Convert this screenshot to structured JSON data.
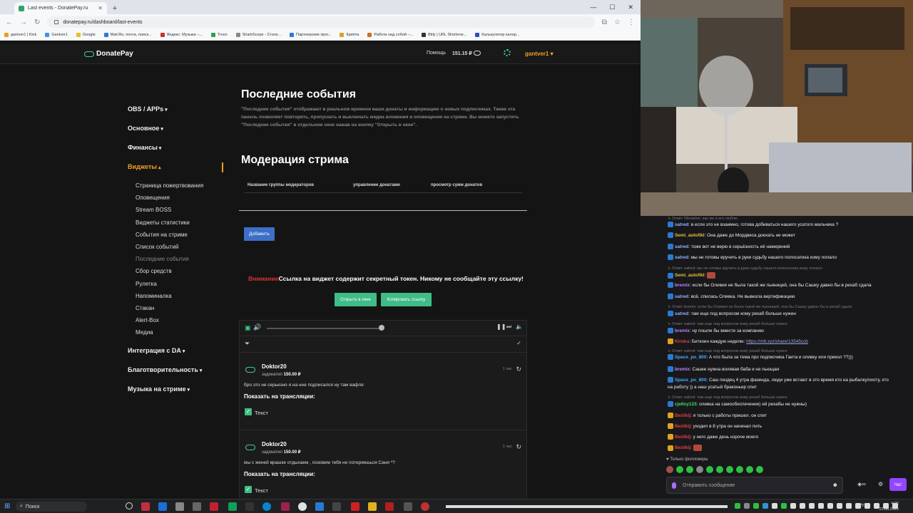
{
  "browser": {
    "tab_title": "Last events - DonatePay.ru",
    "url": "donatepay.ru/dashboard/last-events",
    "bookmarks": [
      "gantver1 | Kick",
      "Gantver1",
      "Google",
      "Mail.Ru: почта, поиск...",
      "Яндекс: Музыка –...",
      "Trovo",
      "SharkScope - Стати...",
      "Партнерские прог...",
      "Крипта",
      "Работа над собой –...",
      "Bitly | URL Shortene...",
      "Калькулятор калор..."
    ]
  },
  "header": {
    "logo": "DonatePay",
    "help": "Помощь",
    "balance": "151.15 ₽",
    "username": "gantver1"
  },
  "sidebar": {
    "groups": [
      "OBS / APPs",
      "Основное",
      "Финансы",
      "Виджеты",
      "Интеграция с DA",
      "Благотворительность",
      "Музыка на стриме"
    ],
    "widget_items": [
      "Страница пожертвования",
      "Оповещения",
      "Stream BOSS",
      "Виджеты статистики",
      "События на стриме",
      "Список событий",
      "Последние события",
      "Сбор средств",
      "Рулетка",
      "Напоминалка",
      "Стакан",
      "Alert-Box",
      "Медиа"
    ]
  },
  "main": {
    "title": "Последние события",
    "description": "\"Последние события\" отображают в реальном времени ваши донаты и информацию о новых подписчиках. Также эта панель позволяет повторять, пропускать и выключать медиа вложения и оповещения на стриме. Вы можете запустить \"Последние события\" в отдельном окне нажав на кнопку \"Открыть в окне\".",
    "moderation_title": "Модерация стрима",
    "mod_columns": [
      "Название группы модераторов",
      "управление донатами",
      "просмотр сумм донатов"
    ],
    "add_button": "Добавить",
    "warning_prefix": "Внимание",
    "warning_text": "Ссылка на виджет содержит секретный токен. Никому не сообщайте эту ссылку!",
    "open_window": "Открыть в окне",
    "copy_link": "Копировать ссылку",
    "events": [
      {
        "name": "Doktor20",
        "donated_label": "задонатил",
        "amount": "150.00 ₽",
        "time": "1 час",
        "message": "бро это не серьезно я на нее подписался ну там вафля",
        "show_label": "Показать на трансляции:",
        "check_label": "Текст"
      },
      {
        "name": "Doktor20",
        "donated_label": "задонатил",
        "amount": "150.00 ₽",
        "time": "1 час",
        "message": "мы с женей врашке отдыхаем , позовем тебя не потеряешься Саня *?",
        "show_label": "Показать на трансляции:",
        "check_label": "Текст"
      }
    ]
  },
  "chat": {
    "lines": [
      {
        "type": "reply",
        "text": "Ответ Obviative: как же я его люблю"
      },
      {
        "user": "satred",
        "color": "#8fb4ff",
        "text": "в если это не взаимно, готова добиваться нашего усатого мальчика ?"
      },
      {
        "user": "Semi_autofikl",
        "color": "#e0c040",
        "text": "Она даже до Мордвеса доехать не может"
      },
      {
        "user": "satred",
        "color": "#8fb4ff",
        "text": "тоже вот не верю в серьёзность её намерений"
      },
      {
        "user": "satred",
        "color": "#8fb4ff",
        "text": "мы не готовы вручить в руки судьбу нашего полосатика кому попало"
      },
      {
        "type": "reply",
        "text": "Ответ satred: мы не готовы вручить в руки судьбу нашего полосатика кому попало"
      },
      {
        "user": "Semi_autofikl",
        "color": "#e0c040",
        "text": ""
      },
      {
        "user": "bremix",
        "color": "#c080ff",
        "text": "если бы Оливия не была такой же пьяницей, она бы Сашку давно бы в рехаб сдала"
      },
      {
        "user": "satred",
        "color": "#8fb4ff",
        "text": "всё, спилась Оливка. Не вывезла вертификацию"
      },
      {
        "type": "reply",
        "text": "Ответ bremix: если бы Оливия не была такой же пьяницей, она бы Сашку давно бы в рехаб сдала"
      },
      {
        "user": "satred",
        "color": "#8fb4ff",
        "text": "там еще под вопросом кому рехаб больше нужен"
      },
      {
        "type": "reply",
        "text": "Ответ satred: там еще под вопросом кому рехаб больше нужен"
      },
      {
        "user": "bremix",
        "color": "#c080ff",
        "text": "ну пошли бы вместе за компанию"
      },
      {
        "user": "Kiroku",
        "color": "#e04040",
        "text": "Биткоин каждую неделю: ",
        "link": "https://mtt.xyz/share/13545ccb"
      },
      {
        "type": "reply",
        "text": "Ответ satred: там еще под вопросом кому рехаб больше нужен"
      },
      {
        "user": "Space_po_800",
        "color": "#4aa8ff",
        "text": "А что была за тема про подписчика Гаита и оливку или прикол ??)))"
      },
      {
        "user": "bremix",
        "color": "#c080ff",
        "text": "Сашке нужна волевая баба и не пьющая"
      },
      {
        "user": "Space_po_800",
        "color": "#4aa8ff",
        "text": "Саш пиздец 4 утра фазенда, люди уже встают в это время кто на рыбалку/охоту, кто"
      },
      {
        "type": "cont",
        "text": "на работу )) а наш усатый браконьер спит"
      },
      {
        "type": "reply",
        "text": "Ответ satred: там еще под вопросом кому рехаб больше нужен"
      },
      {
        "user": "cjelloy123",
        "color": "#40e060",
        "text": "оливка на самообеспечении) ей рехабы не нужны)"
      },
      {
        "user": "Bezlikij",
        "color": "#e04040",
        "text": "я только с работы пришел. он спит"
      },
      {
        "user": "Bezlikij",
        "color": "#e04040",
        "text": "уходил в 8 утра он начинал пить"
      },
      {
        "user": "Bezlikij",
        "color": "#e04040",
        "text": "у него даже день короче моего"
      },
      {
        "user": "Bezlikij",
        "color": "#e04040",
        "text": ""
      }
    ],
    "followers_only": "Только фолловеры",
    "placeholder": "Отправить сообщение",
    "chat_button": "Чат"
  },
  "taskbar": {
    "search": "Поиск",
    "lang": "РУС",
    "time": "4:22",
    "date": "21.08.2025"
  }
}
